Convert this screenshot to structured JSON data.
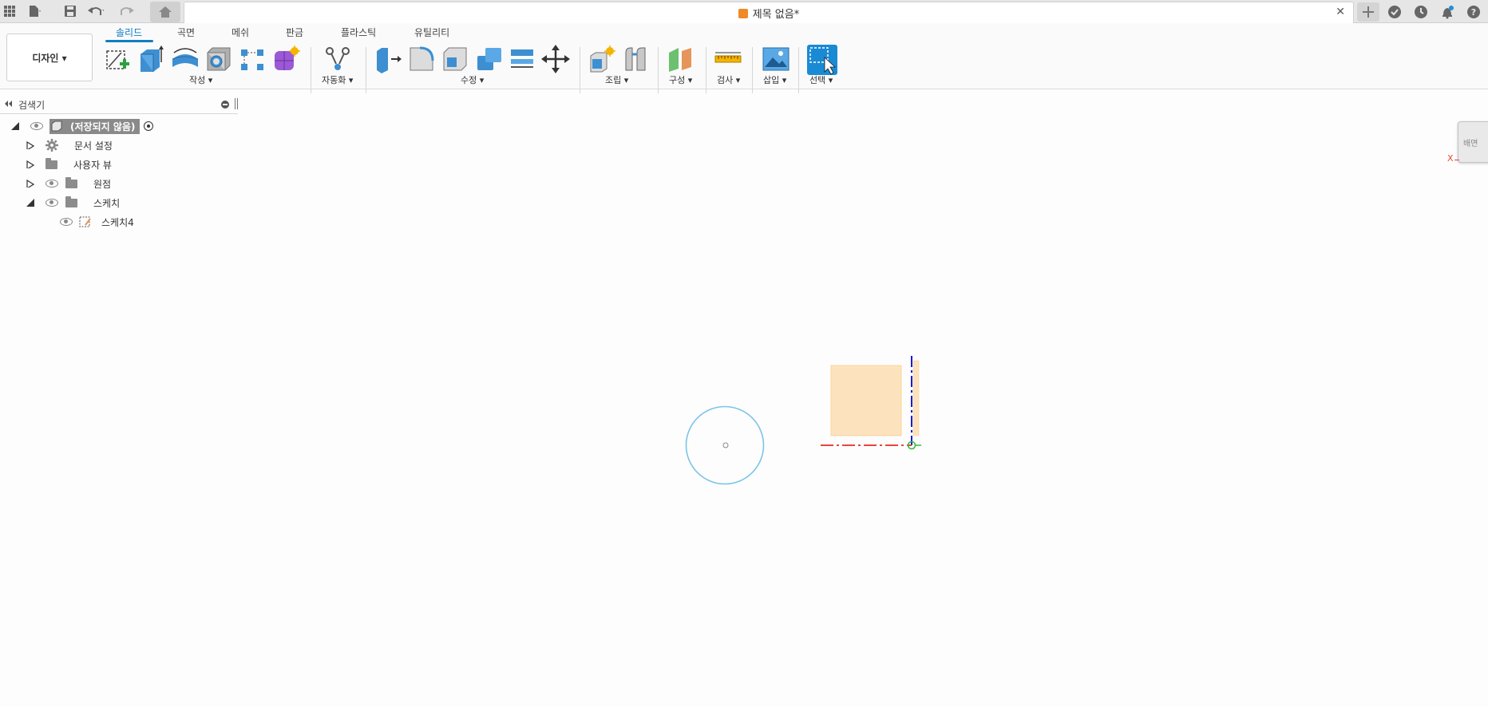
{
  "topbar": {
    "doc_title": "제목 없음*",
    "icons": [
      "apps-grid-icon",
      "file-icon",
      "save-icon",
      "undo-icon",
      "redo-icon",
      "home-icon"
    ],
    "right_icons": [
      "new-tab-plus-icon",
      "online-status-icon",
      "job-status-icon",
      "notifications-icon",
      "help-icon"
    ]
  },
  "toolbar": {
    "workspace_label": "디자인 ▾",
    "tabs": [
      {
        "label": "솔리드",
        "active": true
      },
      {
        "label": "곡면"
      },
      {
        "label": "메쉬"
      },
      {
        "label": "판금"
      },
      {
        "label": "플라스틱"
      },
      {
        "label": "유틸리티"
      }
    ],
    "groups": [
      {
        "label": "작성 ▾"
      },
      {
        "label": "자동화 ▾"
      },
      {
        "label": "수정 ▾"
      },
      {
        "label": "조립 ▾"
      },
      {
        "label": "구성 ▾"
      },
      {
        "label": "검사 ▾"
      },
      {
        "label": "삽입 ▾"
      },
      {
        "label": "선택 ▾"
      }
    ]
  },
  "browser": {
    "title": "검색기",
    "root_label": "(저장되지 않음)",
    "items": [
      {
        "label": "문서 설정"
      },
      {
        "label": "사용자 뷰"
      },
      {
        "label": "원점"
      },
      {
        "label": "스케치"
      },
      {
        "label": "스케치4"
      }
    ]
  },
  "viewcube": {
    "label": "배면"
  },
  "canvas": {
    "axis_x_label": "X"
  },
  "colors": {
    "accent": "#0f7ec4",
    "circle": "#7cc5e6",
    "sketch_fill": "#fde3bd",
    "x_axis": "#e8463a",
    "y_axis": "#1a1ae0",
    "origin": "#33bb33"
  }
}
